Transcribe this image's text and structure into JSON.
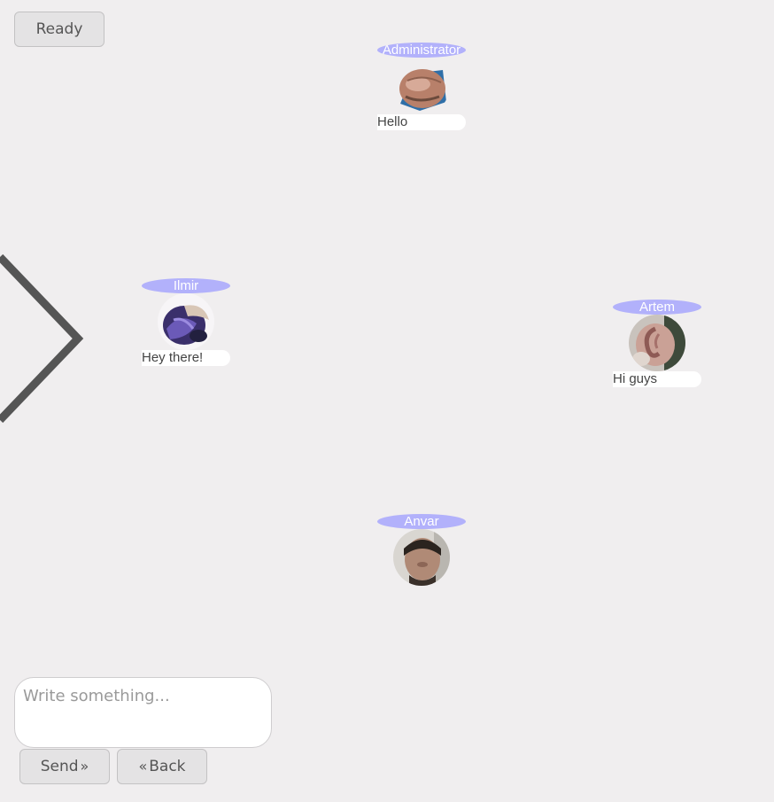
{
  "toolbar": {
    "ready_label": "Ready"
  },
  "participants": [
    {
      "name": "Administrator",
      "message": "Hello",
      "avatar_icon": "face-photo-avatar"
    },
    {
      "name": "Ilmir",
      "message": "Hey there!",
      "avatar_icon": "abstract-purple-avatar"
    },
    {
      "name": "Artem",
      "message": "Hi guys",
      "avatar_icon": "ear-photo-avatar"
    },
    {
      "name": "Anvar",
      "message": "",
      "avatar_icon": "face-photo-avatar"
    }
  ],
  "composer": {
    "placeholder": "Write something...",
    "value": "",
    "send_label": "Send",
    "back_label": "Back",
    "send_icon": "double-chevron-right-icon",
    "back_icon": "double-chevron-left-icon"
  },
  "navigation": {
    "arrow_icon": "chevron-right-icon"
  },
  "colors": {
    "background": "#f0eeef",
    "name_pill": "#b2b1fb",
    "bubble": "#ffffff",
    "button": "#e4e3e4"
  }
}
